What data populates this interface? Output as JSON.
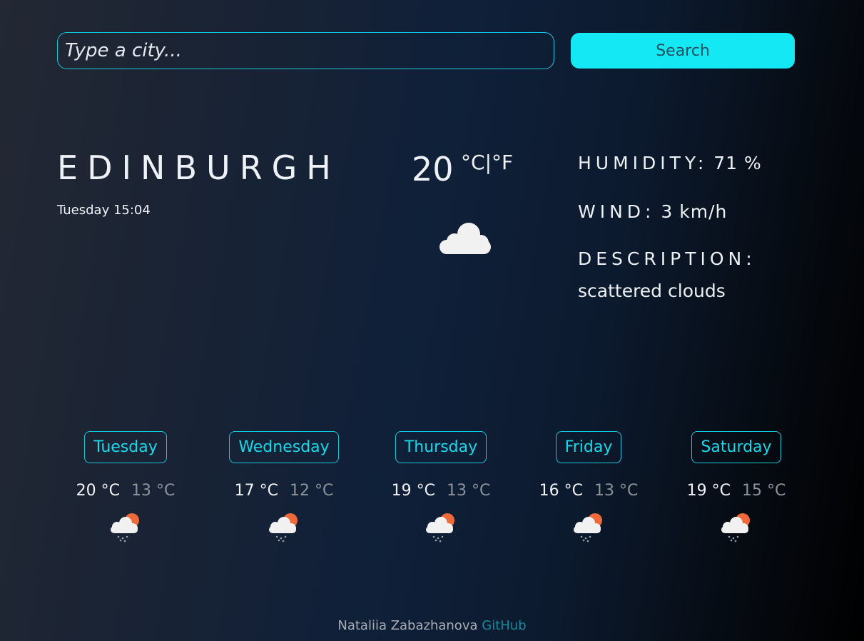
{
  "search": {
    "placeholder": "Type a city...",
    "value": "",
    "button_label": "Search"
  },
  "current": {
    "city": "EDINBURGH",
    "date_time": "Tuesday 15:04",
    "temperature": "20",
    "unit_celsius": "°C",
    "unit_separator": "|",
    "unit_fahrenheit": "°F",
    "icon": "cloud-icon",
    "humidity_label": "HUMIDITY:",
    "humidity_value": "71 %",
    "wind_label": "WIND:",
    "wind_value": "3 km/h",
    "description_label": "DESCRIPTION:",
    "description_value": "scattered clouds"
  },
  "forecast": [
    {
      "day": "Tuesday",
      "max": "20 °C",
      "min": "13 °C",
      "icon": "rain-sun-cloud-icon"
    },
    {
      "day": "Wednesday",
      "max": "17 °C",
      "min": "12 °C",
      "icon": "rain-sun-cloud-icon"
    },
    {
      "day": "Thursday",
      "max": "19 °C",
      "min": "13 °C",
      "icon": "rain-sun-cloud-icon"
    },
    {
      "day": "Friday",
      "max": "16 °C",
      "min": "13 °C",
      "icon": "rain-sun-cloud-icon"
    },
    {
      "day": "Saturday",
      "max": "19 °C",
      "min": "15 °C",
      "icon": "rain-sun-cloud-icon"
    }
  ],
  "footer": {
    "author": "Nataliia Zabazhanova",
    "link_label": "GitHub"
  },
  "colors": {
    "accent": "#13e8f4",
    "border_accent": "#15c8dc",
    "text": "#eef1f5",
    "min_temp": "#8c939c",
    "link": "#178a9c"
  }
}
